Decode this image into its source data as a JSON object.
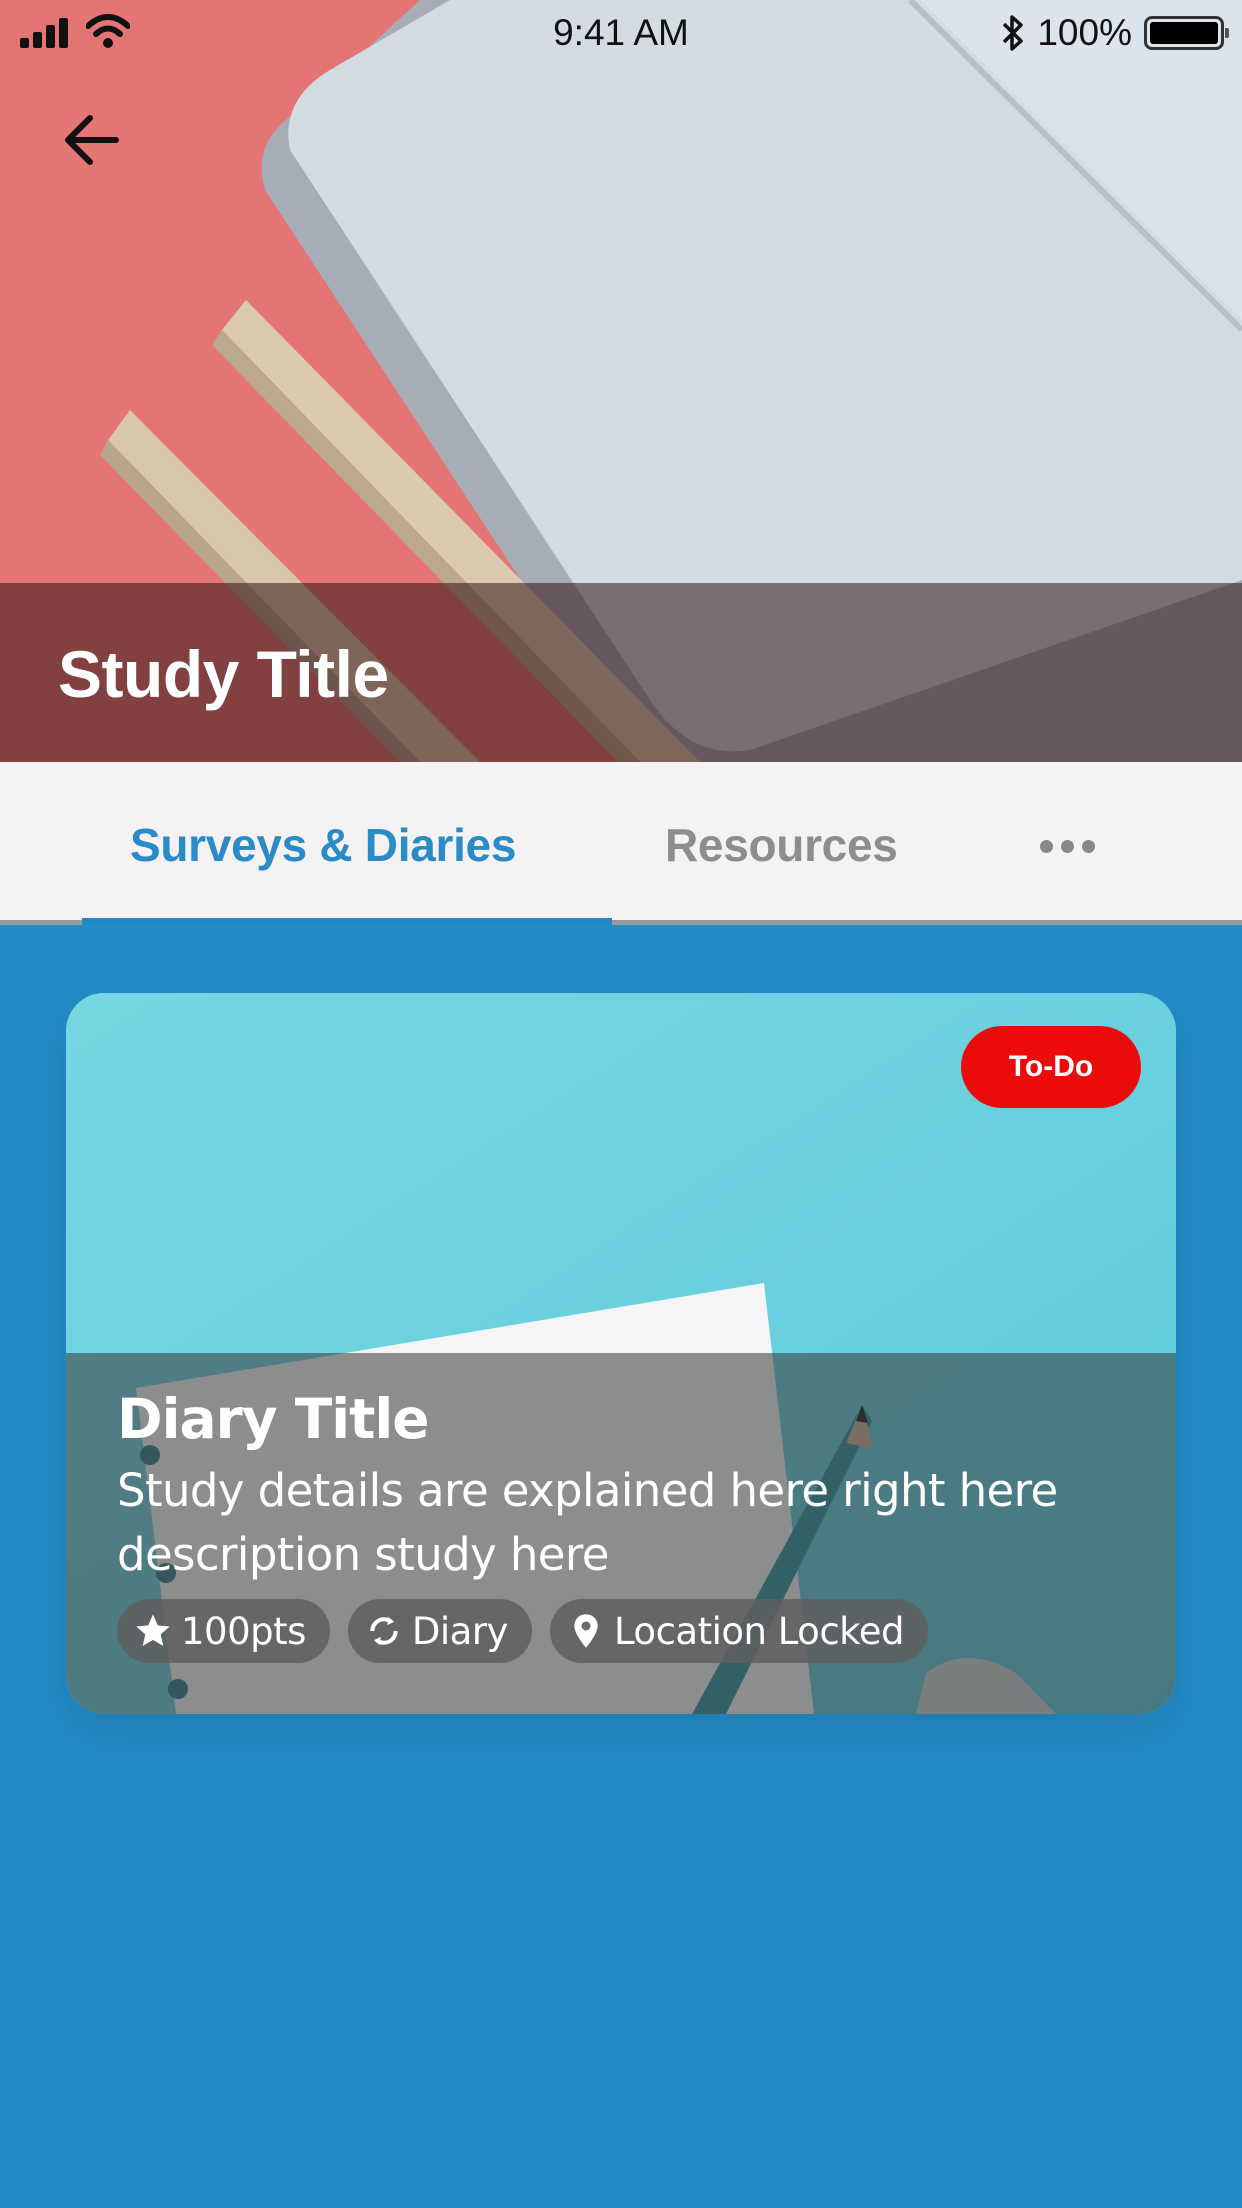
{
  "status_bar": {
    "time": "9:41 AM",
    "battery_percent": "100%",
    "battery_level": 1.0,
    "icons": [
      "signal-icon",
      "wifi-icon",
      "bluetooth-icon",
      "battery-icon"
    ]
  },
  "header": {
    "back_icon": "arrow-left-icon",
    "title": "Study Title"
  },
  "tabs": {
    "items": [
      {
        "label": "Surveys & Diaries",
        "active": true
      },
      {
        "label": "Resources",
        "active": false
      }
    ],
    "more_icon": "more-horizontal-icon",
    "active_color": "#2a8bc6",
    "inactive_color": "#8d8d8d"
  },
  "content": {
    "background_color": "#238cc6",
    "cards": [
      {
        "status_badge": "To-Do",
        "status_color": "#ec0b0b",
        "title": "Diary Title",
        "description": "Study details are explained here right here description study here",
        "chips": [
          {
            "icon": "star-icon",
            "label": "100pts"
          },
          {
            "icon": "repeat-icon",
            "label": "Diary"
          },
          {
            "icon": "location-pin-icon",
            "label": "Location Locked"
          }
        ]
      }
    ]
  }
}
